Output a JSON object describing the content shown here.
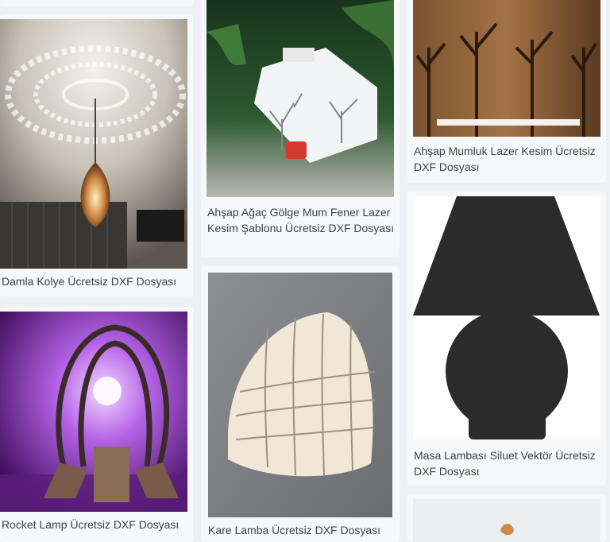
{
  "gallery": {
    "items": [
      {
        "title": "Damla Kolye Ücretsiz DXF Dosyası",
        "image": "pendant-lamp-shadow-photo"
      },
      {
        "title": "Rocket Lamp Ücretsiz DXF Dosyası",
        "image": "rocket-lamp-purple-photo"
      },
      {
        "title": "Ahşap Ağaç Gölge Mum Fener Lazer Kesim Şablonu Ücretsiz DXF Dosyası",
        "image": "tree-lantern-photo"
      },
      {
        "title": "Kare Lamba Ücretsiz DXF Dosyası",
        "image": "grid-lamp-photo"
      },
      {
        "title": "Ahşap Mumluk Lazer Kesim Ücretsiz DXF Dosyası",
        "image": "tree-candle-holder-photo"
      },
      {
        "title": "Masa Lambası Siluet Vektör Ücretsiz DXF Dosyası",
        "image": "table-lamp-silhouette"
      }
    ]
  }
}
